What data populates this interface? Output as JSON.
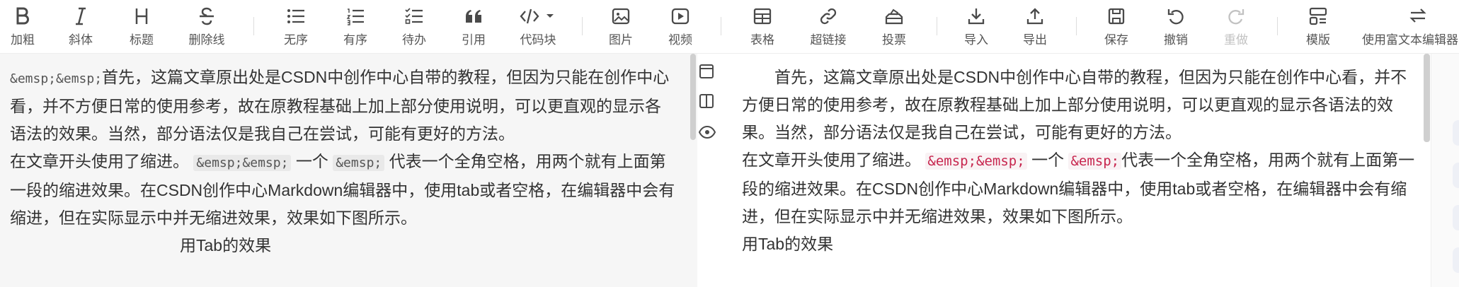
{
  "toolbar": {
    "items": [
      {
        "label": "加粗",
        "icon": "bold-icon"
      },
      {
        "label": "斜体",
        "icon": "italic-icon"
      },
      {
        "label": "标题",
        "icon": "heading-icon"
      },
      {
        "label": "删除线",
        "icon": "strikethrough-icon"
      },
      {
        "label": "无序",
        "icon": "unordered-list-icon"
      },
      {
        "label": "有序",
        "icon": "ordered-list-icon"
      },
      {
        "label": "待办",
        "icon": "todo-list-icon"
      },
      {
        "label": "引用",
        "icon": "quote-icon"
      },
      {
        "label": "代码块",
        "icon": "code-block-icon"
      },
      {
        "label": "图片",
        "icon": "image-icon"
      },
      {
        "label": "视频",
        "icon": "video-icon"
      },
      {
        "label": "表格",
        "icon": "table-icon"
      },
      {
        "label": "超链接",
        "icon": "link-icon"
      },
      {
        "label": "投票",
        "icon": "vote-icon"
      },
      {
        "label": "导入",
        "icon": "import-icon"
      },
      {
        "label": "导出",
        "icon": "export-icon"
      },
      {
        "label": "保存",
        "icon": "save-icon"
      },
      {
        "label": "撤销",
        "icon": "undo-icon"
      },
      {
        "label": "重做",
        "icon": "redo-icon",
        "disabled": true
      },
      {
        "label": "模版",
        "icon": "template-icon"
      },
      {
        "label": "使用富文本编辑器",
        "icon": "switch-editor-icon"
      }
    ]
  },
  "editor": {
    "p1_code": "&emsp;&emsp;",
    "p1_text": "首先，这篇文章原出处是CSDN中创作中心自带的教程，但因为只能在创作中心看，并不方便日常的使用参考，故在原教程基础上加上部分使用说明，可以更直观的显示各语法的效果。当然，部分语法仅是我自己在尝试，可能有更好的方法。",
    "p2_pre": "在文章开头使用了缩进。",
    "p2_code1": "&emsp;&emsp;",
    "p2_mid": "一个",
    "p2_code2": "&emsp;",
    "p2_post": "代表一个全角空格，用两个就有上面第一段的缩进效果。在CSDN创作中心Markdown编辑器中，使用tab或者空格，在编辑器中会有缩进，但在实际显示中并无缩进效果，效果如下图所示。",
    "p3_text": "用Tab的效果"
  },
  "preview": {
    "p1_text": "首先，这篇文章原出处是CSDN中创作中心自带的教程，但因为只能在创作中心看，并不方便日常的使用参考，故在原教程基础上加上部分使用说明，可以更直观的显示各语法的效果。当然，部分语法仅是我自己在尝试，可能有更好的方法。",
    "p2_pre": "在文章开头使用了缩进。",
    "p2_code1": "&emsp;&emsp;",
    "p2_mid": "一个",
    "p2_code2": "&emsp;",
    "p2_post": "代表一个全角空格，用两个就有上面第一段的缩进效果。在CSDN创作中心Markdown编辑器中，使用tab或者空格，在编辑器中会有缩进，但在实际显示中并无缩进效果，效果如下图所示。",
    "p3_text": "用Tab的效果"
  },
  "rail": {
    "icons": [
      "layout-top-icon",
      "split-view-icon",
      "preview-eye-icon"
    ]
  },
  "colors": {
    "icon": "#4a4a4a",
    "disabled": "#c2c2c2",
    "code_red": "#c7254e",
    "editor_bg": "#f6f6f6"
  }
}
